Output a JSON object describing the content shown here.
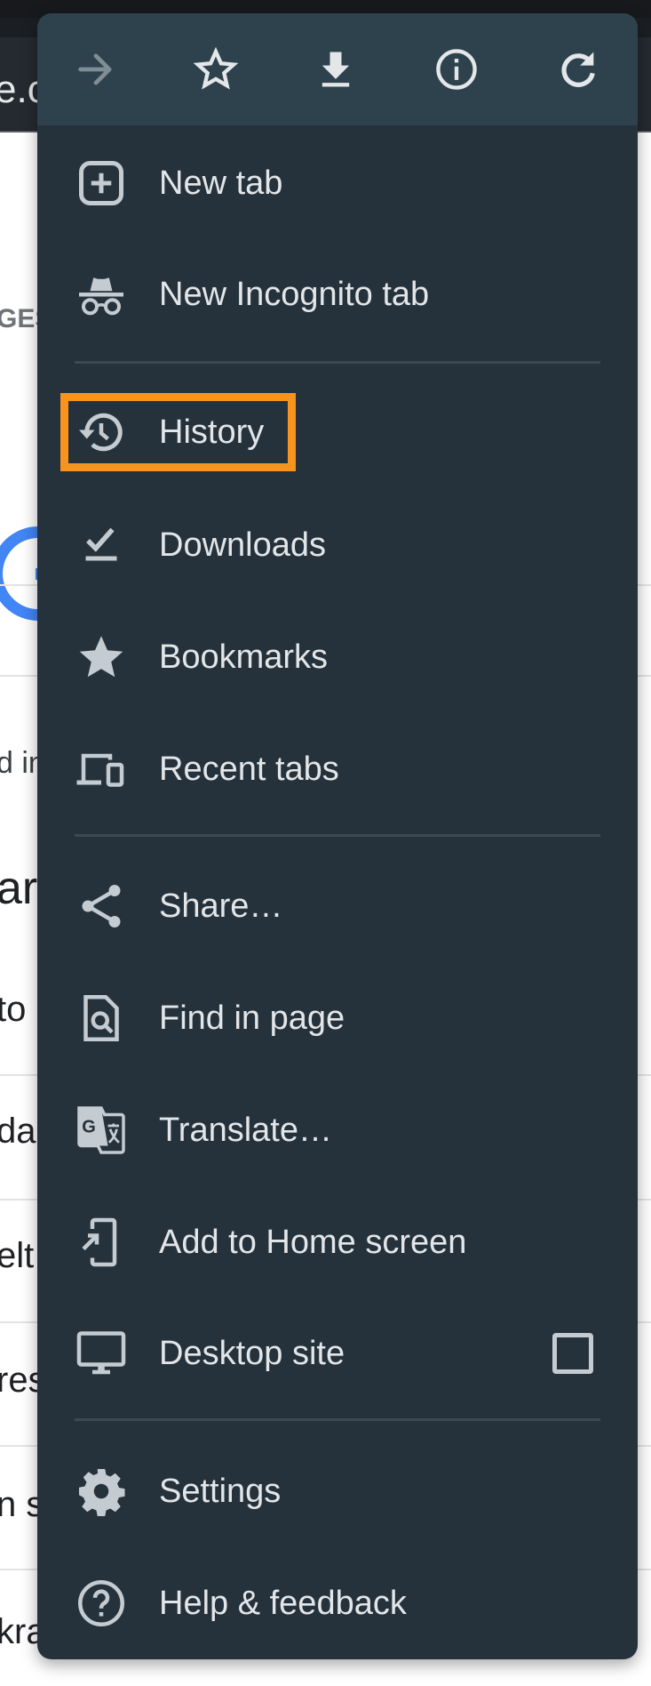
{
  "background_page": {
    "url_fragment": "e.co",
    "tab_fragment": "GES",
    "text_fragments": [
      "d in",
      "ar",
      "to",
      "da",
      "elt",
      "res",
      "n s",
      "kra"
    ],
    "logo": "google-g-logo",
    "logo_color": "#4285f4"
  },
  "menu": {
    "header_icons": [
      {
        "name": "forward-arrow-icon",
        "label": "Forward",
        "enabled": false
      },
      {
        "name": "star-outline-icon",
        "label": "Bookmark this page",
        "enabled": true
      },
      {
        "name": "download-icon",
        "label": "Download",
        "enabled": true
      },
      {
        "name": "info-icon",
        "label": "Page info",
        "enabled": true
      },
      {
        "name": "refresh-icon",
        "label": "Refresh",
        "enabled": true
      }
    ],
    "items": [
      {
        "id": "new-tab",
        "label": "New tab",
        "icon": "plus-box-icon"
      },
      {
        "id": "new-incognito-tab",
        "label": "New Incognito tab",
        "icon": "incognito-icon"
      },
      {
        "id": "history",
        "label": "History",
        "icon": "history-icon",
        "highlighted": true
      },
      {
        "id": "downloads",
        "label": "Downloads",
        "icon": "download-done-icon"
      },
      {
        "id": "bookmarks",
        "label": "Bookmarks",
        "icon": "star-icon"
      },
      {
        "id": "recent-tabs",
        "label": "Recent tabs",
        "icon": "devices-icon"
      },
      {
        "id": "share",
        "label": "Share…",
        "icon": "share-icon"
      },
      {
        "id": "find-in-page",
        "label": "Find in page",
        "icon": "find-in-page-icon"
      },
      {
        "id": "translate",
        "label": "Translate…",
        "icon": "translate-icon"
      },
      {
        "id": "add-to-home-screen",
        "label": "Add to Home screen",
        "icon": "add-to-home-icon"
      },
      {
        "id": "desktop-site",
        "label": "Desktop site",
        "icon": "monitor-icon",
        "checkbox": true,
        "checked": false
      },
      {
        "id": "settings",
        "label": "Settings",
        "icon": "gear-icon"
      },
      {
        "id": "help-feedback",
        "label": "Help & feedback",
        "icon": "help-icon"
      }
    ]
  },
  "colors": {
    "menu_bg": "#25323c",
    "menu_header_bg": "#2d424d",
    "menu_text": "#e3e6e8",
    "icon": "#c4cbd1",
    "icon_disabled": "#7f8d95",
    "highlight": "#f7941d"
  }
}
